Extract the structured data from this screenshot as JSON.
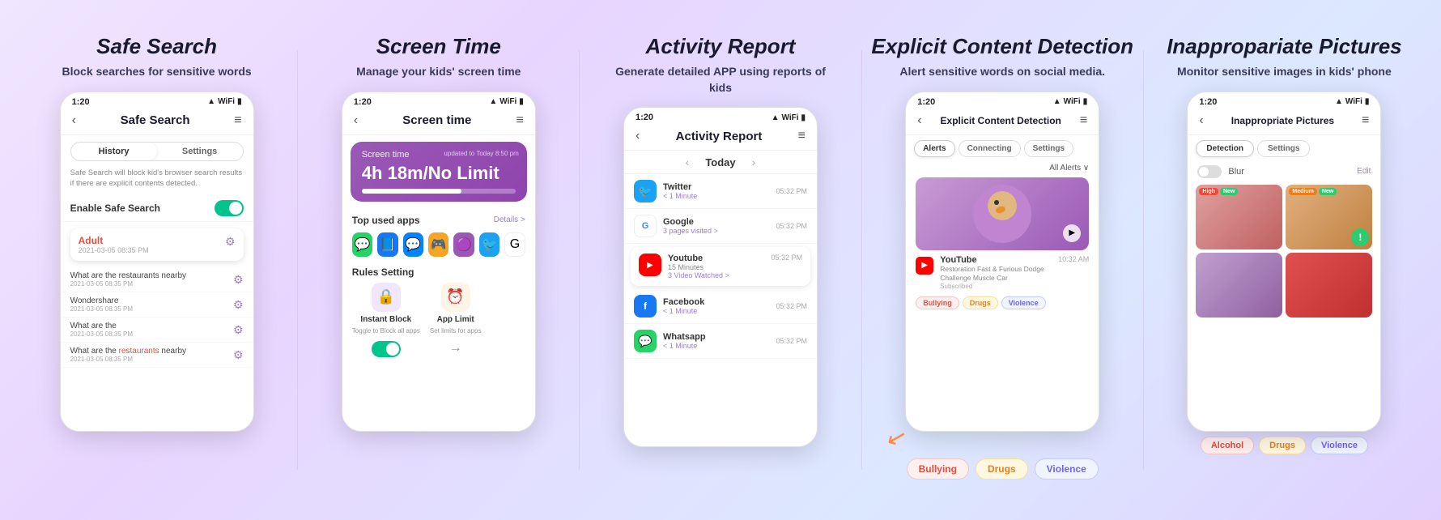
{
  "features": [
    {
      "id": "safe-search",
      "title": "Safe Search",
      "description": "Block searches for sensitive words",
      "phone": {
        "statusTime": "1:20",
        "headerTitle": "Safe Search",
        "tabs": [
          "History",
          "Settings"
        ],
        "activeTab": "History",
        "descText": "Safe Search will block kid's browser search results if there are explicit contents detected.",
        "enableLabel": "Enable Safe Search",
        "alertWord": "Adult",
        "alertTime": "2021-03-05 08:35 PM",
        "searches": [
          {
            "text": "What are the restaurants nearby",
            "time": "2021-03-05 08:35 PM"
          },
          {
            "text": "Wondershare",
            "time": "2021-03-05 08:35 PM"
          },
          {
            "text": "What are the",
            "time": "2021-03-05 08:35 PM"
          },
          {
            "text": "What are the restaurants nearby",
            "time": "2021-03-05 08:35 PM"
          }
        ]
      }
    },
    {
      "id": "screen-time",
      "title": "Screen Time",
      "description": "Manage your kids' screen time",
      "phone": {
        "statusTime": "1:20",
        "headerTitle": "Screen time",
        "screenTimeValue": "4h 18m",
        "screenTimeLimit": "No Limit",
        "screenTimeLabel": "Screen time",
        "updatedText": "updated to Today 8:50 pm",
        "topAppsLabel": "Top used apps",
        "detailsLink": "Details >",
        "apps": [
          "💬",
          "📘",
          "💬",
          "🎮",
          "🟣",
          "🐦",
          "🔍"
        ],
        "rulesTitle": "Rules Setting",
        "rules": [
          {
            "name": "Instant Block",
            "desc": "Toggle to Block all apps",
            "icon": "🔒",
            "color": "#9b59b6"
          },
          {
            "name": "App Limit",
            "desc": "Set limits for apps",
            "icon": "⏰",
            "color": "#e67e22"
          }
        ]
      }
    },
    {
      "id": "activity-report",
      "title": "Activity Report",
      "description": "Generate detailed APP using reports of kids",
      "phone": {
        "statusTime": "1:20",
        "headerTitle": "Activity Report",
        "navLabel": "Today",
        "activities": [
          {
            "app": "Twitter",
            "icon": "🐦",
            "iconBg": "#1da1f2",
            "time": "05:32 PM",
            "sub": "< 1 Minute"
          },
          {
            "app": "Google",
            "icon": "G",
            "iconBg": "#fff",
            "time": "05:32 PM",
            "sub": "3 pages visited >"
          },
          {
            "app": "Youtube",
            "icon": "▶",
            "iconBg": "#ff0000",
            "time": "05:32 PM",
            "sub": "15 Minutes",
            "sub2": "3 Video Watched >"
          },
          {
            "app": "Facebook",
            "icon": "f",
            "iconBg": "#1877f2",
            "time": "05:32 PM",
            "sub": "< 1 Minute"
          },
          {
            "app": "Whatsapp",
            "icon": "💬",
            "iconBg": "#25d366",
            "time": "05:32 PM",
            "sub": "< 1 Minute"
          }
        ]
      }
    },
    {
      "id": "explicit-content",
      "title": "Explicit Content Detection",
      "description": "Alert sensitive words on social media.",
      "phone": {
        "statusTime": "1:20",
        "headerTitle": "Explicit Content Detection",
        "tabs": [
          "Alerts",
          "Connecting",
          "Settings"
        ],
        "activeTab": "Alerts",
        "filterLabel": "All Alerts ∨",
        "ytName": "YouTube",
        "ytTime": "10:32 AM",
        "ytDesc": "Restoration Fast & Furious Dodge Challenge Muscle Car",
        "ytSub": "Subscribed",
        "tags": [
          "Bullying",
          "Drugs",
          "Violence"
        ],
        "bottomTags": [
          "Bullying",
          "Drugs",
          "Violence"
        ]
      }
    },
    {
      "id": "inappropriate-pictures",
      "title": "Inappropariate Pictures",
      "description": "Monitor sensitive images in kids' phone",
      "phone": {
        "statusTime": "1:20",
        "headerTitle": "Inappropriate Pictures",
        "tabs": [
          "Detection",
          "Settings"
        ],
        "activeTab": "Detection",
        "blurLabel": "Blur",
        "editLabel": "Edit",
        "images": [
          {
            "level": "High",
            "isNew": true,
            "severity": "high"
          },
          {
            "level": "Medium",
            "isNew": true,
            "severity": "medium"
          },
          {
            "level": null,
            "isNew": false,
            "severity": "purple"
          },
          {
            "level": null,
            "isNew": false,
            "severity": "red2"
          }
        ],
        "bottomBadges": [
          "Alcohol",
          "Drugs",
          "Violence"
        ]
      }
    }
  ]
}
